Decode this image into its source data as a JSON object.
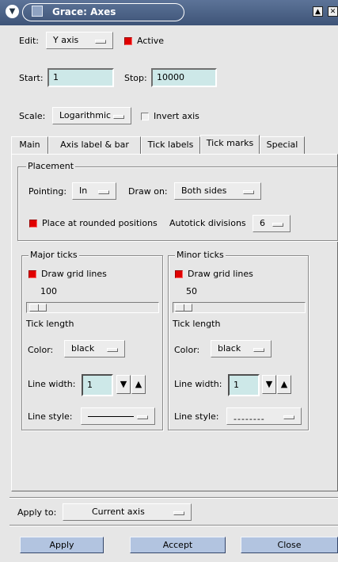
{
  "window": {
    "title": "Grace: Axes",
    "menu_icon": "chevron-down-icon",
    "app_icon": "app-window-icon",
    "maximize_icon": "maximize-icon",
    "close_icon": "close-icon"
  },
  "edit": {
    "label": "Edit:",
    "value": "Y axis",
    "active_label": "Active",
    "active_checked": true
  },
  "range": {
    "start_label": "Start:",
    "start_value": "1",
    "stop_label": "Stop:",
    "stop_value": "10000"
  },
  "scale": {
    "label": "Scale:",
    "value": "Logarithmic",
    "invert_label": "Invert axis",
    "invert_checked": false
  },
  "tabs": [
    {
      "label": "Main",
      "active": false
    },
    {
      "label": "Axis label & bar",
      "active": false
    },
    {
      "label": "Tick labels",
      "active": false
    },
    {
      "label": "Tick marks",
      "active": true
    },
    {
      "label": "Special",
      "active": false
    }
  ],
  "placement": {
    "title": "Placement",
    "pointing_label": "Pointing:",
    "pointing_value": "In",
    "draw_on_label": "Draw on:",
    "draw_on_value": "Both sides",
    "rounded_label": "Place at rounded positions",
    "rounded_checked": true,
    "autotick_label": "Autotick divisions",
    "autotick_value": "6"
  },
  "major": {
    "title": "Major ticks",
    "grid_label": "Draw grid lines",
    "grid_checked": true,
    "value": "100",
    "tick_length_label": "Tick length",
    "color_label": "Color:",
    "color_value": "black",
    "line_width_label": "Line width:",
    "line_width_value": "1",
    "line_style_label": "Line style:",
    "line_style": "solid",
    "down_icon": "arrow-down-icon",
    "up_icon": "arrow-up-icon"
  },
  "minor": {
    "title": "Minor ticks",
    "grid_label": "Draw grid lines",
    "grid_checked": true,
    "value": "50",
    "tick_length_label": "Tick length",
    "color_label": "Color:",
    "color_value": "black",
    "line_width_label": "Line width:",
    "line_width_value": "1",
    "line_style_label": "Line style:",
    "line_style_text": "--------",
    "down_icon": "arrow-down-icon",
    "up_icon": "arrow-up-icon"
  },
  "apply_to": {
    "label": "Apply to:",
    "value": "Current axis"
  },
  "buttons": {
    "apply": "Apply",
    "accept": "Accept",
    "close": "Close"
  },
  "colors": {
    "titlebar": "#4a6088",
    "field_bg": "#cde8e8",
    "check_on": "#e00000",
    "button_bg": "#b2c4e0"
  }
}
